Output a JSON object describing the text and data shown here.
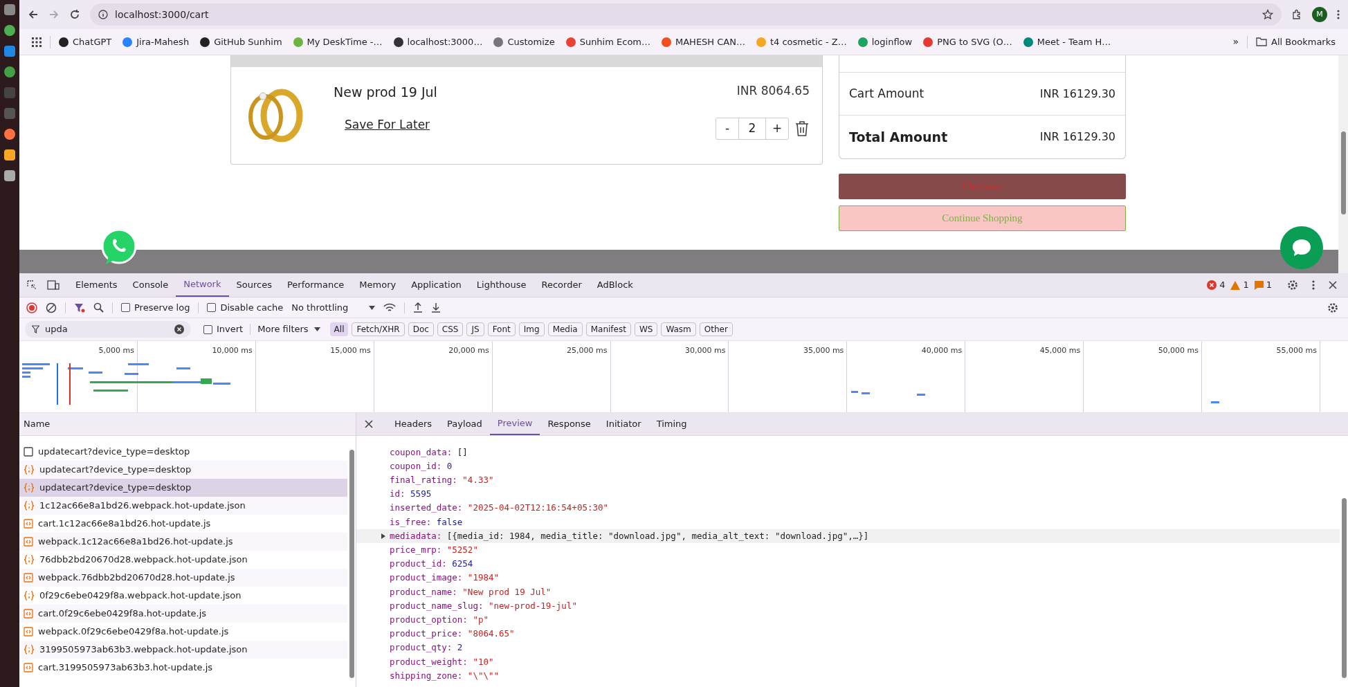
{
  "browser": {
    "url": "localhost:3000/cart",
    "avatar": "M",
    "bookmarks": [
      {
        "label": "ChatGPT",
        "color": "#222222"
      },
      {
        "label": "Jira-Mahesh",
        "color": "#2684ff"
      },
      {
        "label": "GitHub Sunhim",
        "color": "#222222"
      },
      {
        "label": "My DeskTime -…",
        "color": "#6cb33f"
      },
      {
        "label": "localhost:3000…",
        "color": "#333333"
      },
      {
        "label": "Customize",
        "color": "#777777"
      },
      {
        "label": "Sunhim Ecom…",
        "color": "#ea4335"
      },
      {
        "label": "MAHESH CAN…",
        "color": "#f24e1e"
      },
      {
        "label": "t4 cosmetic - Z…",
        "color": "#f5a623"
      },
      {
        "label": "loginflow",
        "color": "#1ea362"
      },
      {
        "label": "PNG to SVG (O…",
        "color": "#e53935"
      },
      {
        "label": "Meet - Team H…",
        "color": "#00897b"
      }
    ],
    "more_bookmarks": "»",
    "all_bookmarks": "All Bookmarks"
  },
  "cart": {
    "product": {
      "name": "New prod 19 Jul",
      "price": "INR 8064.65",
      "save_for_later": "Save For Later",
      "quantity": "2",
      "minus": "-",
      "plus": "+"
    },
    "summary": [
      {
        "label": "Cart Amount",
        "value": "INR 16129.30",
        "bold": false
      },
      {
        "label": "Total Amount",
        "value": "INR 16129.30",
        "bold": true
      }
    ],
    "checkout": "Checkout",
    "continue_shopping": "Continue Shopping"
  },
  "devtools": {
    "tabs": [
      {
        "label": "Elements",
        "selected": false
      },
      {
        "label": "Console",
        "selected": false
      },
      {
        "label": "Network",
        "selected": true
      },
      {
        "label": "Sources",
        "selected": false
      },
      {
        "label": "Performance",
        "selected": false
      },
      {
        "label": "Memory",
        "selected": false
      },
      {
        "label": "Application",
        "selected": false
      },
      {
        "label": "Lighthouse",
        "selected": false
      },
      {
        "label": "Recorder",
        "selected": false
      },
      {
        "label": "AdBlock",
        "selected": false
      }
    ],
    "errors": "4",
    "warnings": "1",
    "issues": "1",
    "preserve_log": {
      "label": "Preserve log",
      "checked": false
    },
    "disable_cache": {
      "label": "Disable cache",
      "checked": false
    },
    "throttling": "No throttling",
    "filter": {
      "value": "upda"
    },
    "invert": {
      "label": "Invert",
      "checked": false
    },
    "more_filters": "More filters",
    "types": [
      {
        "label": "All",
        "selected": true
      },
      {
        "label": "Fetch/XHR",
        "selected": false
      },
      {
        "label": "Doc",
        "selected": false
      },
      {
        "label": "CSS",
        "selected": false
      },
      {
        "label": "JS",
        "selected": false
      },
      {
        "label": "Font",
        "selected": false
      },
      {
        "label": "Img",
        "selected": false
      },
      {
        "label": "Media",
        "selected": false
      },
      {
        "label": "Manifest",
        "selected": false
      },
      {
        "label": "WS",
        "selected": false
      },
      {
        "label": "Wasm",
        "selected": false
      },
      {
        "label": "Other",
        "selected": false
      }
    ],
    "timeline_ticks": [
      "5,000 ms",
      "10,000 ms",
      "15,000 ms",
      "20,000 ms",
      "25,000 ms",
      "30,000 ms",
      "35,000 ms",
      "40,000 ms",
      "45,000 ms",
      "50,000 ms",
      "55,000 ms"
    ],
    "name_column": "Name",
    "requests": [
      {
        "name": "updatecart?device_type=desktop",
        "kind": "doc",
        "selected": false
      },
      {
        "name": "updatecart?device_type=desktop",
        "kind": "json",
        "selected": false
      },
      {
        "name": "updatecart?device_type=desktop",
        "kind": "json",
        "selected": true
      },
      {
        "name": "1c12ac66e8a1bd26.webpack.hot-update.json",
        "kind": "json",
        "selected": false
      },
      {
        "name": "cart.1c12ac66e8a1bd26.hot-update.js",
        "kind": "js",
        "selected": false
      },
      {
        "name": "webpack.1c12ac66e8a1bd26.hot-update.js",
        "kind": "js",
        "selected": false
      },
      {
        "name": "76dbb2bd20670d28.webpack.hot-update.json",
        "kind": "json",
        "selected": false
      },
      {
        "name": "webpack.76dbb2bd20670d28.hot-update.js",
        "kind": "js",
        "selected": false
      },
      {
        "name": "0f29c6ebe0429f8a.webpack.hot-update.json",
        "kind": "json",
        "selected": false
      },
      {
        "name": "cart.0f29c6ebe0429f8a.hot-update.js",
        "kind": "js",
        "selected": false
      },
      {
        "name": "webpack.0f29c6ebe0429f8a.hot-update.js",
        "kind": "js",
        "selected": false
      },
      {
        "name": "3199505973ab63b3.webpack.hot-update.json",
        "kind": "json",
        "selected": false
      },
      {
        "name": "cart.3199505973ab63b3.hot-update.js",
        "kind": "js",
        "selected": false
      }
    ],
    "detail_tabs": [
      {
        "label": "Headers",
        "selected": false
      },
      {
        "label": "Payload",
        "selected": false
      },
      {
        "label": "Preview",
        "selected": true
      },
      {
        "label": "Response",
        "selected": false
      },
      {
        "label": "Initiator",
        "selected": false
      },
      {
        "label": "Timing",
        "selected": false
      }
    ],
    "preview": [
      {
        "key": "coupon_data:",
        "value": "[]",
        "kind": "plain",
        "expandable": false,
        "highlighted": false
      },
      {
        "key": "coupon_id:",
        "value": "0",
        "kind": "number",
        "expandable": false,
        "highlighted": false
      },
      {
        "key": "final_rating:",
        "value": "\"4.33\"",
        "kind": "string",
        "expandable": false,
        "highlighted": false
      },
      {
        "key": "id:",
        "value": "5595",
        "kind": "number",
        "expandable": false,
        "highlighted": false
      },
      {
        "key": "inserted_date:",
        "value": "\"2025-04-02T12:16:54+05:30\"",
        "kind": "string",
        "expandable": false,
        "highlighted": false
      },
      {
        "key": "is_free:",
        "value": "false",
        "kind": "number",
        "expandable": false,
        "highlighted": false
      },
      {
        "key": "mediadata:",
        "value": "[{media_id: 1984, media_title: \"download.jpg\", media_alt_text: \"download.jpg\",…}]",
        "kind": "plain",
        "expandable": true,
        "highlighted": true
      },
      {
        "key": "price_mrp:",
        "value": "\"5252\"",
        "kind": "string",
        "expandable": false,
        "highlighted": false
      },
      {
        "key": "product_id:",
        "value": "6254",
        "kind": "number",
        "expandable": false,
        "highlighted": false
      },
      {
        "key": "product_image:",
        "value": "\"1984\"",
        "kind": "string",
        "expandable": false,
        "highlighted": false
      },
      {
        "key": "product_name:",
        "value": "\"New prod 19 Jul\"",
        "kind": "string",
        "expandable": false,
        "highlighted": false
      },
      {
        "key": "product_name_slug:",
        "value": "\"new-prod-19-jul\"",
        "kind": "string",
        "expandable": false,
        "highlighted": false
      },
      {
        "key": "product_option:",
        "value": "\"p\"",
        "kind": "string",
        "expandable": false,
        "highlighted": false
      },
      {
        "key": "product_price:",
        "value": "\"8064.65\"",
        "kind": "string",
        "expandable": false,
        "highlighted": false
      },
      {
        "key": "product_qty:",
        "value": "2",
        "kind": "number",
        "expandable": false,
        "highlighted": false
      },
      {
        "key": "product_weight:",
        "value": "\"10\"",
        "kind": "string",
        "expandable": false,
        "highlighted": false
      },
      {
        "key": "shipping_zone:",
        "value": "\"\\\"\\\"\"",
        "kind": "string",
        "expandable": false,
        "highlighted": false
      }
    ]
  }
}
